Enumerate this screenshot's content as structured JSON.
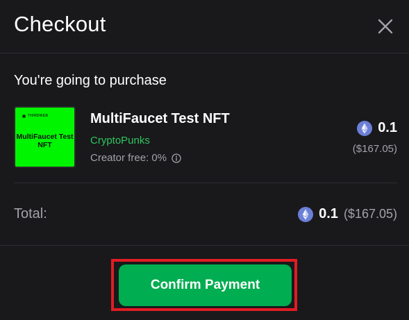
{
  "dialog": {
    "title": "Checkout",
    "close_icon": "close-icon"
  },
  "purchase": {
    "subtitle": "You're going to purchase",
    "item": {
      "thumbnail": {
        "brand_text": "THIRDWEB",
        "title": "MultiFaucet Test NFT",
        "background_color": "#00f500"
      },
      "name": "MultiFaucet Test NFT",
      "collection": "CryptoPunks",
      "creator_fee": "Creator free: 0%",
      "info_icon": "info-icon",
      "currency_icon": "ethereum-icon",
      "price": "0.1",
      "price_usd": "($167.05)"
    }
  },
  "total": {
    "label": "Total:",
    "currency_icon": "ethereum-icon",
    "value": "0.1",
    "value_usd": "($167.05)"
  },
  "actions": {
    "confirm_label": "Confirm Payment",
    "confirm_color": "#00ad50",
    "highlight_color": "#e11c23"
  },
  "colors": {
    "background": "#19191b",
    "accent_green": "#2ec55e",
    "muted_text": "#a2a2aa"
  }
}
